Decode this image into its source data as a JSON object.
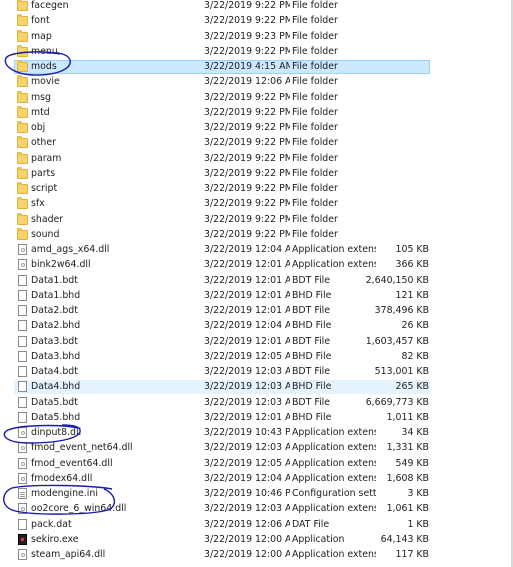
{
  "highlight_color": "#cce8ff",
  "annotation_color": "#1c1aa8",
  "files": [
    {
      "name": "facegen",
      "date": "3/22/2019 9:22 PM",
      "type": "File folder",
      "size": "",
      "icon": "folder-icon"
    },
    {
      "name": "font",
      "date": "3/22/2019 9:22 PM",
      "type": "File folder",
      "size": "",
      "icon": "folder-icon"
    },
    {
      "name": "map",
      "date": "3/22/2019 9:23 PM",
      "type": "File folder",
      "size": "",
      "icon": "folder-icon"
    },
    {
      "name": "menu",
      "date": "3/22/2019 9:22 PM",
      "type": "File folder",
      "size": "",
      "icon": "folder-icon"
    },
    {
      "name": "mods",
      "date": "3/22/2019 4:15 AM",
      "type": "File folder",
      "size": "",
      "icon": "folder-icon",
      "state": "selected"
    },
    {
      "name": "movie",
      "date": "3/22/2019 12:06 AM",
      "type": "File folder",
      "size": "",
      "icon": "folder-icon"
    },
    {
      "name": "msg",
      "date": "3/22/2019 9:22 PM",
      "type": "File folder",
      "size": "",
      "icon": "folder-icon"
    },
    {
      "name": "mtd",
      "date": "3/22/2019 9:22 PM",
      "type": "File folder",
      "size": "",
      "icon": "folder-icon"
    },
    {
      "name": "obj",
      "date": "3/22/2019 9:22 PM",
      "type": "File folder",
      "size": "",
      "icon": "folder-icon"
    },
    {
      "name": "other",
      "date": "3/22/2019 9:22 PM",
      "type": "File folder",
      "size": "",
      "icon": "folder-icon"
    },
    {
      "name": "param",
      "date": "3/22/2019 9:22 PM",
      "type": "File folder",
      "size": "",
      "icon": "folder-icon"
    },
    {
      "name": "parts",
      "date": "3/22/2019 9:22 PM",
      "type": "File folder",
      "size": "",
      "icon": "folder-icon"
    },
    {
      "name": "script",
      "date": "3/22/2019 9:22 PM",
      "type": "File folder",
      "size": "",
      "icon": "folder-icon"
    },
    {
      "name": "sfx",
      "date": "3/22/2019 9:22 PM",
      "type": "File folder",
      "size": "",
      "icon": "folder-icon"
    },
    {
      "name": "shader",
      "date": "3/22/2019 9:22 PM",
      "type": "File folder",
      "size": "",
      "icon": "folder-icon"
    },
    {
      "name": "sound",
      "date": "3/22/2019 9:22 PM",
      "type": "File folder",
      "size": "",
      "icon": "folder-icon"
    },
    {
      "name": "amd_ags_x64.dll",
      "date": "3/22/2019 12:04 AM",
      "type": "Application extens...",
      "size": "105 KB",
      "icon": "dll-file-icon"
    },
    {
      "name": "bink2w64.dll",
      "date": "3/22/2019 12:01 AM",
      "type": "Application extens...",
      "size": "366 KB",
      "icon": "dll-file-icon"
    },
    {
      "name": "Data1.bdt",
      "date": "3/22/2019 12:01 AM",
      "type": "BDT File",
      "size": "2,640,150 KB",
      "icon": "file-icon"
    },
    {
      "name": "Data1.bhd",
      "date": "3/22/2019 12:01 AM",
      "type": "BHD File",
      "size": "121 KB",
      "icon": "file-icon"
    },
    {
      "name": "Data2.bdt",
      "date": "3/22/2019 12:01 AM",
      "type": "BDT File",
      "size": "378,496 KB",
      "icon": "file-icon"
    },
    {
      "name": "Data2.bhd",
      "date": "3/22/2019 12:04 AM",
      "type": "BHD File",
      "size": "26 KB",
      "icon": "file-icon"
    },
    {
      "name": "Data3.bdt",
      "date": "3/22/2019 12:01 AM",
      "type": "BDT File",
      "size": "1,603,457 KB",
      "icon": "file-icon"
    },
    {
      "name": "Data3.bhd",
      "date": "3/22/2019 12:05 AM",
      "type": "BHD File",
      "size": "82 KB",
      "icon": "file-icon"
    },
    {
      "name": "Data4.bdt",
      "date": "3/22/2019 12:03 AM",
      "type": "BDT File",
      "size": "513,001 KB",
      "icon": "file-icon"
    },
    {
      "name": "Data4.bhd",
      "date": "3/22/2019 12:03 AM",
      "type": "BHD File",
      "size": "265 KB",
      "icon": "file-icon",
      "state": "hovered"
    },
    {
      "name": "Data5.bdt",
      "date": "3/22/2019 12:03 AM",
      "type": "BDT File",
      "size": "6,669,773 KB",
      "icon": "file-icon"
    },
    {
      "name": "Data5.bhd",
      "date": "3/22/2019 12:01 AM",
      "type": "BHD File",
      "size": "1,011 KB",
      "icon": "file-icon"
    },
    {
      "name": "dinput8.dll",
      "date": "3/22/2019 10:43 PM",
      "type": "Application extens...",
      "size": "34 KB",
      "icon": "dll-file-icon"
    },
    {
      "name": "fmod_event_net64.dll",
      "date": "3/22/2019 12:03 AM",
      "type": "Application extens...",
      "size": "1,331 KB",
      "icon": "dll-file-icon"
    },
    {
      "name": "fmod_event64.dll",
      "date": "3/22/2019 12:05 AM",
      "type": "Application extens...",
      "size": "549 KB",
      "icon": "dll-file-icon"
    },
    {
      "name": "fmodex64.dll",
      "date": "3/22/2019 12:04 AM",
      "type": "Application extens...",
      "size": "1,608 KB",
      "icon": "dll-file-icon"
    },
    {
      "name": "modengine.ini",
      "date": "3/22/2019 10:46 PM",
      "type": "Configuration sett...",
      "size": "3 KB",
      "icon": "ini-file-icon"
    },
    {
      "name": "oo2core_6_win64.dll",
      "date": "3/22/2019 12:03 AM",
      "type": "Application extens...",
      "size": "1,061 KB",
      "icon": "dll-file-icon"
    },
    {
      "name": "pack.dat",
      "date": "3/22/2019 12:06 AM",
      "type": "DAT File",
      "size": "1 KB",
      "icon": "file-icon"
    },
    {
      "name": "sekiro.exe",
      "date": "3/22/2019 12:00 AM",
      "type": "Application",
      "size": "64,143 KB",
      "icon": "exe-icon"
    },
    {
      "name": "steam_api64.dll",
      "date": "3/22/2019 12:00 AM",
      "type": "Application extens...",
      "size": "117 KB",
      "icon": "dll-file-icon"
    }
  ]
}
